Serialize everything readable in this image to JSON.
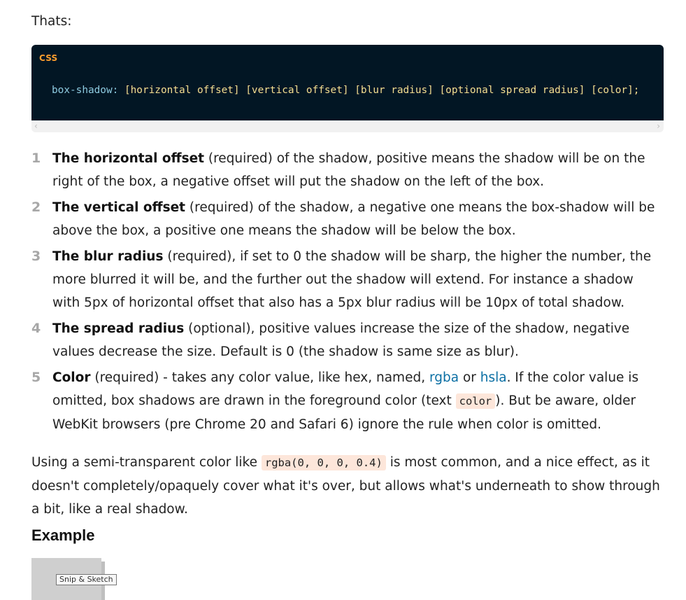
{
  "intro_text": "Thats:",
  "code_block": {
    "language_label": "CSS",
    "property": "box-shadow:",
    "value": "[horizontal offset] [vertical offset] [blur radius] [optional spread radius] [color];",
    "scroll_left": "‹",
    "scroll_right": "›"
  },
  "params": [
    {
      "number": "1",
      "term": "The horizontal offset",
      "text": " (required) of the shadow, positive means the shadow will be on the right of the box, a negative offset will put the shadow on the left of the box."
    },
    {
      "number": "2",
      "term": "The vertical offset",
      "text": " (required) of the shadow, a negative one means the box-shadow will be above the box, a positive one means the shadow will be below the box."
    },
    {
      "number": "3",
      "term": "The blur radius",
      "text": " (required), if set to 0 the shadow will be sharp, the higher the number, the more blurred it will be, and the further out the shadow will extend. For instance a shadow with 5px of horizontal offset that also has a 5px blur radius will be 10px of total shadow."
    },
    {
      "number": "4",
      "term": "The spread radius",
      "text": " (optional), positive values increase the size of the shadow, negative values decrease the size. Default is 0 (the shadow is same size as blur)."
    },
    {
      "number": "5",
      "term": "Color",
      "text_before": " (required) - takes any color value, like hex, named, ",
      "link_rgba": "rgba",
      "text_or": " or ",
      "link_hsla": "hsla",
      "text_middle": ". If the color value is omitted, box shadows are drawn in the foreground color (text ",
      "code_color": "color",
      "text_after": "). But be aware, older WebKit browsers (pre Chrome 20 and Safari 6) ignore the rule when color is omitted."
    }
  ],
  "paragraph": {
    "before": "Using a semi-transparent color like ",
    "code": "rgba(0, 0, 0, 0.4)",
    "after": " is most common, and a nice effect, as it doesn't completely/opaquely cover what it's over, but allows what's underneath to show through a bit, like a real shadow."
  },
  "example_heading": "Example",
  "tooltip": "Snip & Sketch"
}
